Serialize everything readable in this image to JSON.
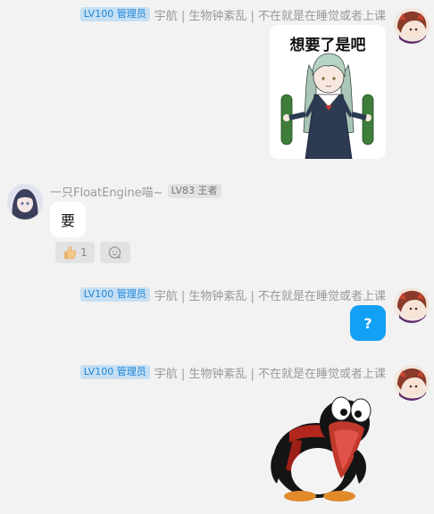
{
  "messages": [
    {
      "badge": "LV100 管理员",
      "name": "宇航 | 生物钟紊乱 | 不在就是在睡觉或者上课",
      "sticker_caption": "想要了是吧"
    },
    {
      "name": "一只FloatEngine喵~",
      "badge": "LV83 王者",
      "text": "要",
      "reaction_count": "1",
      "reactions": [
        "thumbs-up-icon",
        "add-reaction-icon"
      ]
    },
    {
      "badge": "LV100 管理员",
      "name": "宇航 | 生物钟紊乱 | 不在就是在睡觉或者上课",
      "text": "?"
    },
    {
      "badge": "LV100 管理员",
      "name": "宇航 | 生物钟紊乱 | 不在就是在睡觉或者上课",
      "sticker": "penguin-sticker"
    }
  ],
  "colors": {
    "background": "#f2f2f2",
    "admin_badge_bg": "#c6dff3",
    "admin_badge_text": "#1e86d8",
    "self_bubble": "#12a0f5"
  }
}
